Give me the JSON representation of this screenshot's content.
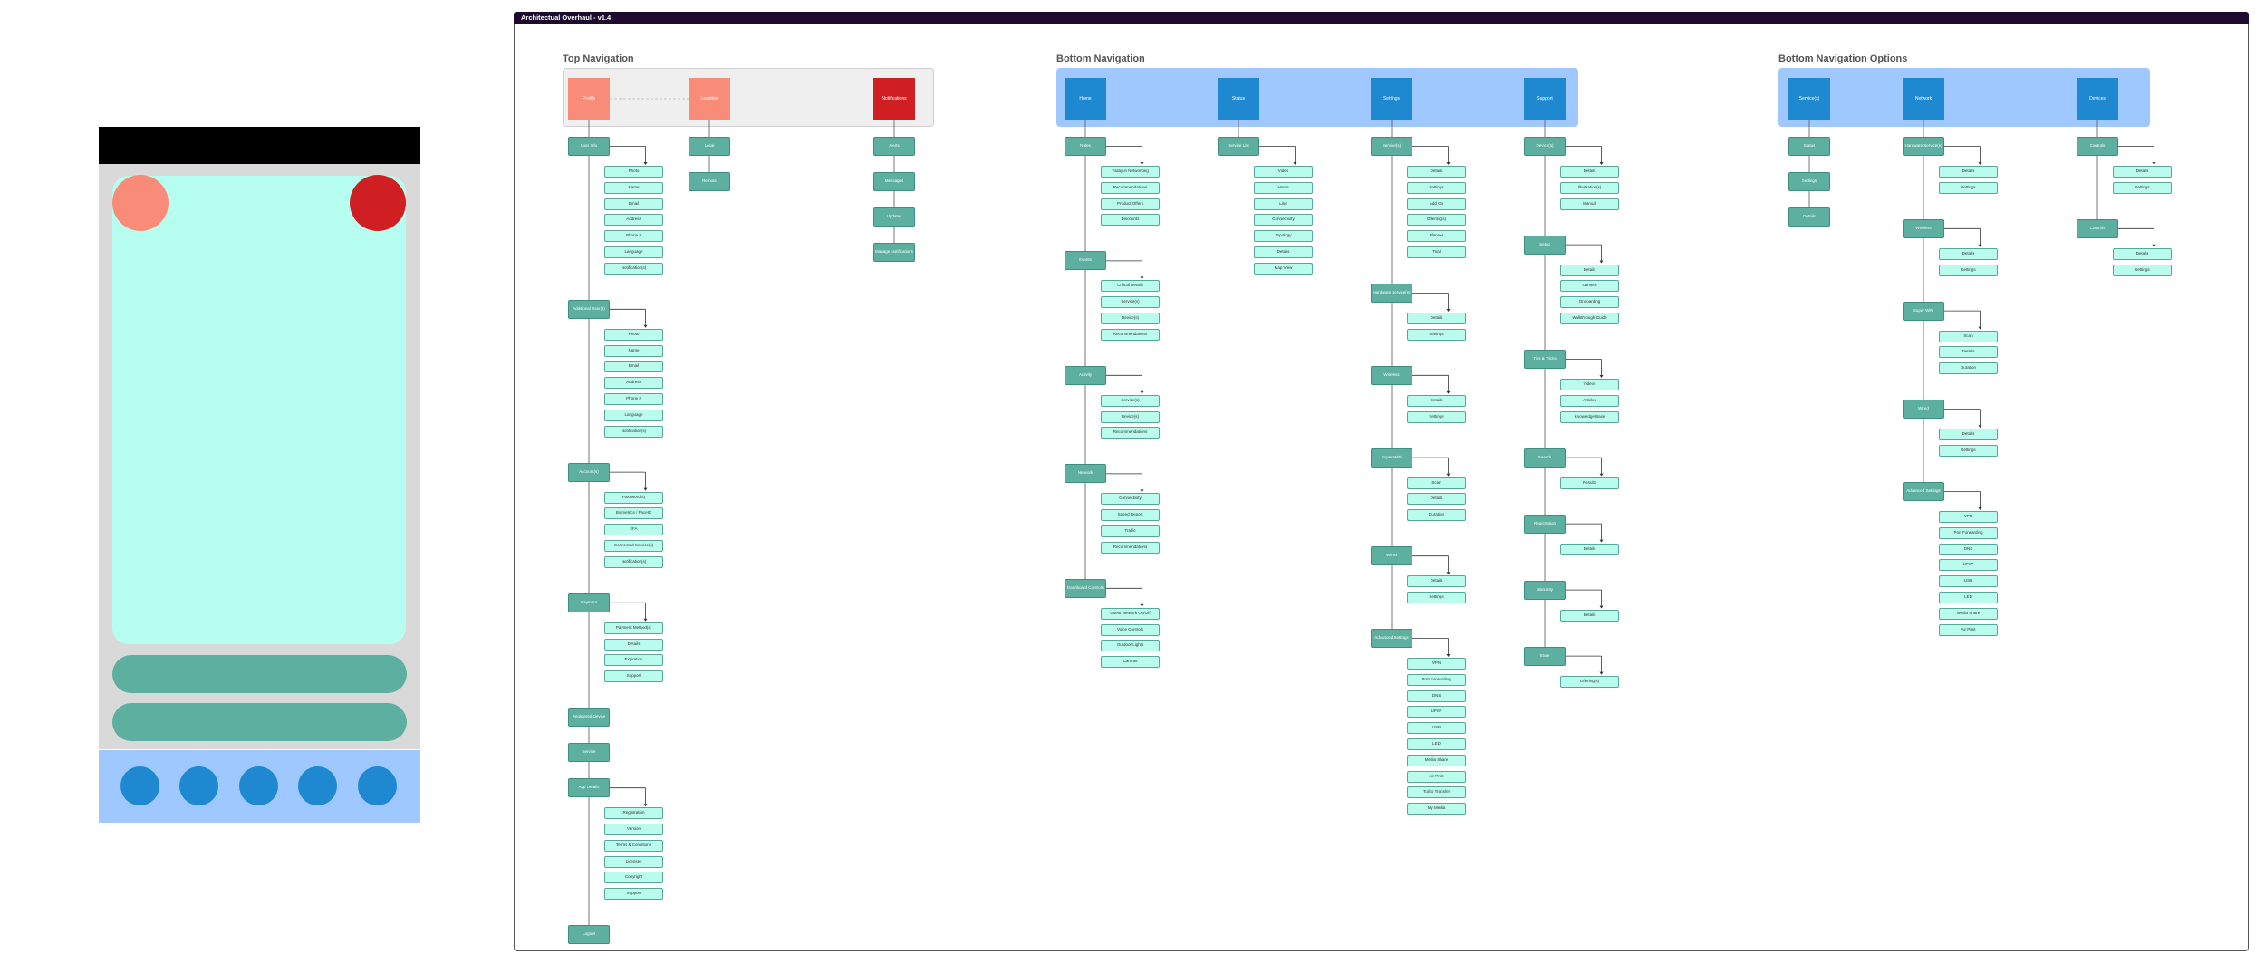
{
  "frame": {
    "title": "Architectual Overhaul - v1.4"
  },
  "colors": {
    "tile_blue": "#1e88d0",
    "band_blue": "#9ec8ff",
    "node": "#5daf9f",
    "leaf": "#b9fbec",
    "salmon": "#f88c78",
    "red": "#d01f22",
    "band_gray": "#efefef"
  },
  "sections": {
    "top": {
      "title": "Top Navigation"
    },
    "bottom": {
      "title": "Bottom Navigation"
    },
    "options": {
      "title": "Bottom Navigation Options"
    }
  },
  "trees": [
    {
      "id": "profile",
      "tile": "Profile",
      "tile_color": "salmon",
      "groups": [
        {
          "node": "User Info",
          "leaves": [
            "Photo",
            "Name",
            "Email",
            "Address",
            "Phone #",
            "Language",
            "Notification(s)"
          ]
        },
        {
          "node": "Additional User(s)",
          "leaves": [
            "Photo",
            "Name",
            "Email",
            "Address",
            "Phone #",
            "Language",
            "Notification(s)"
          ]
        },
        {
          "node": "Account(s)",
          "leaves": [
            "Password(s)",
            "Biometrics / FaceID",
            "2FA",
            "Connected Service(s)",
            "Notification(s)"
          ]
        },
        {
          "node": "Payment",
          "leaves": [
            "Payment Method(s)",
            "Details",
            "Expiration",
            "Support"
          ]
        },
        {
          "node": "Registered Device",
          "leaves": []
        },
        {
          "node": "Service",
          "leaves": []
        },
        {
          "node": "App Details",
          "leaves": [
            "Registration",
            "Version",
            "Terms & Conditions",
            "Licenses",
            "Copyright",
            "Support"
          ]
        },
        {
          "node": "Logout",
          "leaves": []
        }
      ]
    },
    {
      "id": "location",
      "tile": "Location",
      "tile_color": "salmon",
      "groups": [
        {
          "node": "Local",
          "leaves": []
        },
        {
          "node": "Remote",
          "leaves": []
        }
      ]
    },
    {
      "id": "notifications",
      "tile": "Notifications",
      "tile_color": "red",
      "groups": [
        {
          "node": "Alerts",
          "leaves": []
        },
        {
          "node": "Messages",
          "leaves": []
        },
        {
          "node": "Updates",
          "leaves": []
        },
        {
          "node": "Manage Notifications",
          "leaves": []
        }
      ]
    },
    {
      "id": "home",
      "tile": "Home",
      "tile_color": "tile_blue",
      "groups": [
        {
          "node": "Notes",
          "leaves": [
            "Today in Networking",
            "Recommendations",
            "Product Offers",
            "Discounts"
          ]
        },
        {
          "node": "Events",
          "leaves": [
            "Critical Details",
            "Service(s)",
            "Device(s)",
            "Recommendations"
          ]
        },
        {
          "node": "Activity",
          "leaves": [
            "Service(s)",
            "Device(s)",
            "Recommendations"
          ]
        },
        {
          "node": "Network",
          "leaves": [
            "Connectivity",
            "Speed Report",
            "Traffic",
            "Recommendations"
          ]
        },
        {
          "node": "Dashboard Controls",
          "leaves": [
            "Guest Network On/Off",
            "Voice Controls",
            "Outdoor Lights",
            "Camras"
          ]
        }
      ]
    },
    {
      "id": "status",
      "tile": "Status",
      "tile_color": "tile_blue",
      "groups": [
        {
          "node": "Service List",
          "leaves": [
            "Video",
            "Home",
            "Line",
            "Connectivity",
            "Topology",
            "Details",
            "Map View"
          ]
        }
      ]
    },
    {
      "id": "settings",
      "tile": "Settings",
      "tile_color": "tile_blue",
      "groups": [
        {
          "node": "Service(s)",
          "leaves": [
            "Details",
            "Settings",
            "Add On",
            "Offering(s)",
            "Planner",
            "Trial"
          ]
        },
        {
          "node": "Hardware Service(s)",
          "leaves": [
            "Details",
            "Settings"
          ]
        },
        {
          "node": "Wireless",
          "leaves": [
            "Details",
            "Settings"
          ]
        },
        {
          "node": "Super WiFi",
          "leaves": [
            "Scan",
            "Details",
            "Duration"
          ]
        },
        {
          "node": "Wired",
          "leaves": [
            "Details",
            "Settings"
          ]
        },
        {
          "node": "Advanced Settings",
          "leaves": [
            "VPN",
            "Port Forwarding",
            "DNS",
            "UPnP",
            "USB",
            "LED",
            "Media Share",
            "Air Print",
            "Turbo Transfer",
            "My Media"
          ]
        }
      ]
    },
    {
      "id": "support",
      "tile": "Support",
      "tile_color": "tile_blue",
      "groups": [
        {
          "node": "Device(s)",
          "leaves": [
            "Details",
            "Illustration(s)",
            "Manual"
          ]
        },
        {
          "node": "Setup",
          "leaves": [
            "Details",
            "Camera",
            "Onboarding",
            "Walkthrough Guide"
          ]
        },
        {
          "node": "Tips & Tricks",
          "leaves": [
            "Videos",
            "Articles",
            "Knowledge Base"
          ]
        },
        {
          "node": "Search",
          "leaves": [
            "Results"
          ]
        },
        {
          "node": "Registration",
          "leaves": [
            "Details"
          ]
        },
        {
          "node": "Warranty",
          "leaves": [
            "Details"
          ]
        },
        {
          "node": "Store",
          "leaves": [
            "Offering(s)"
          ]
        }
      ]
    },
    {
      "id": "opt-services",
      "tile": "Service(s)",
      "tile_color": "tile_blue",
      "groups": [
        {
          "node": "Status",
          "leaves": []
        },
        {
          "node": "Settings",
          "leaves": []
        },
        {
          "node": "Details",
          "leaves": []
        }
      ]
    },
    {
      "id": "opt-network",
      "tile": "Network",
      "tile_color": "tile_blue",
      "groups": [
        {
          "node": "Hardware Service(s)",
          "leaves": [
            "Details",
            "Settings"
          ]
        },
        {
          "node": "Wireless",
          "leaves": [
            "Details",
            "Settings"
          ]
        },
        {
          "node": "Super WiFi",
          "leaves": [
            "Scan",
            "Details",
            "Duration"
          ]
        },
        {
          "node": "Wired",
          "leaves": [
            "Details",
            "Settings"
          ]
        },
        {
          "node": "Advanced Settings",
          "leaves": [
            "VPN",
            "Port Forwarding",
            "DNS",
            "UPnP",
            "USB",
            "LED",
            "Media Share",
            "Air Print"
          ]
        }
      ]
    },
    {
      "id": "opt-devices",
      "tile": "Devices",
      "tile_color": "tile_blue",
      "groups": [
        {
          "node": "Controls",
          "leaves": [
            "Details",
            "Settings"
          ]
        },
        {
          "node": "Controls",
          "leaves": [
            "Details",
            "Settings"
          ]
        }
      ]
    }
  ]
}
